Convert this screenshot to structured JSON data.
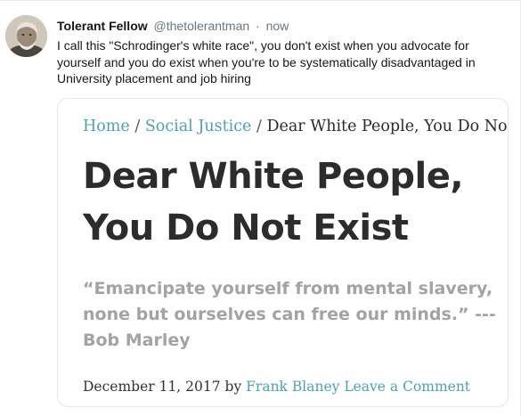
{
  "tweet": {
    "display_name": "Tolerant Fellow",
    "handle": "@thetolerantman",
    "separator": "·",
    "time": "now",
    "text": "I call this \"Schrodinger's white race\", you don't exist when you advocate for yourself and you do exist when you're to be systematically disadvantaged in University placement and job hiring"
  },
  "card": {
    "breadcrumb": {
      "home": "Home",
      "sep1": "/",
      "category": "Social Justice",
      "sep2": "/",
      "current": "Dear White People, You Do Not ..."
    },
    "headline": "Dear White People, You Do Not Exist",
    "quote": "“Emancipate yourself from mental slavery, none but ourselves can free our minds.” --- Bob Marley",
    "byline": {
      "date": "December 11, 2017",
      "by": "by",
      "author": "Frank Blaney",
      "comment_link": "Leave a Comment"
    }
  },
  "colors": {
    "link_teal": "#4aa3b5",
    "quote_gray": "#a3a3a3",
    "meta_gray": "#657786"
  }
}
